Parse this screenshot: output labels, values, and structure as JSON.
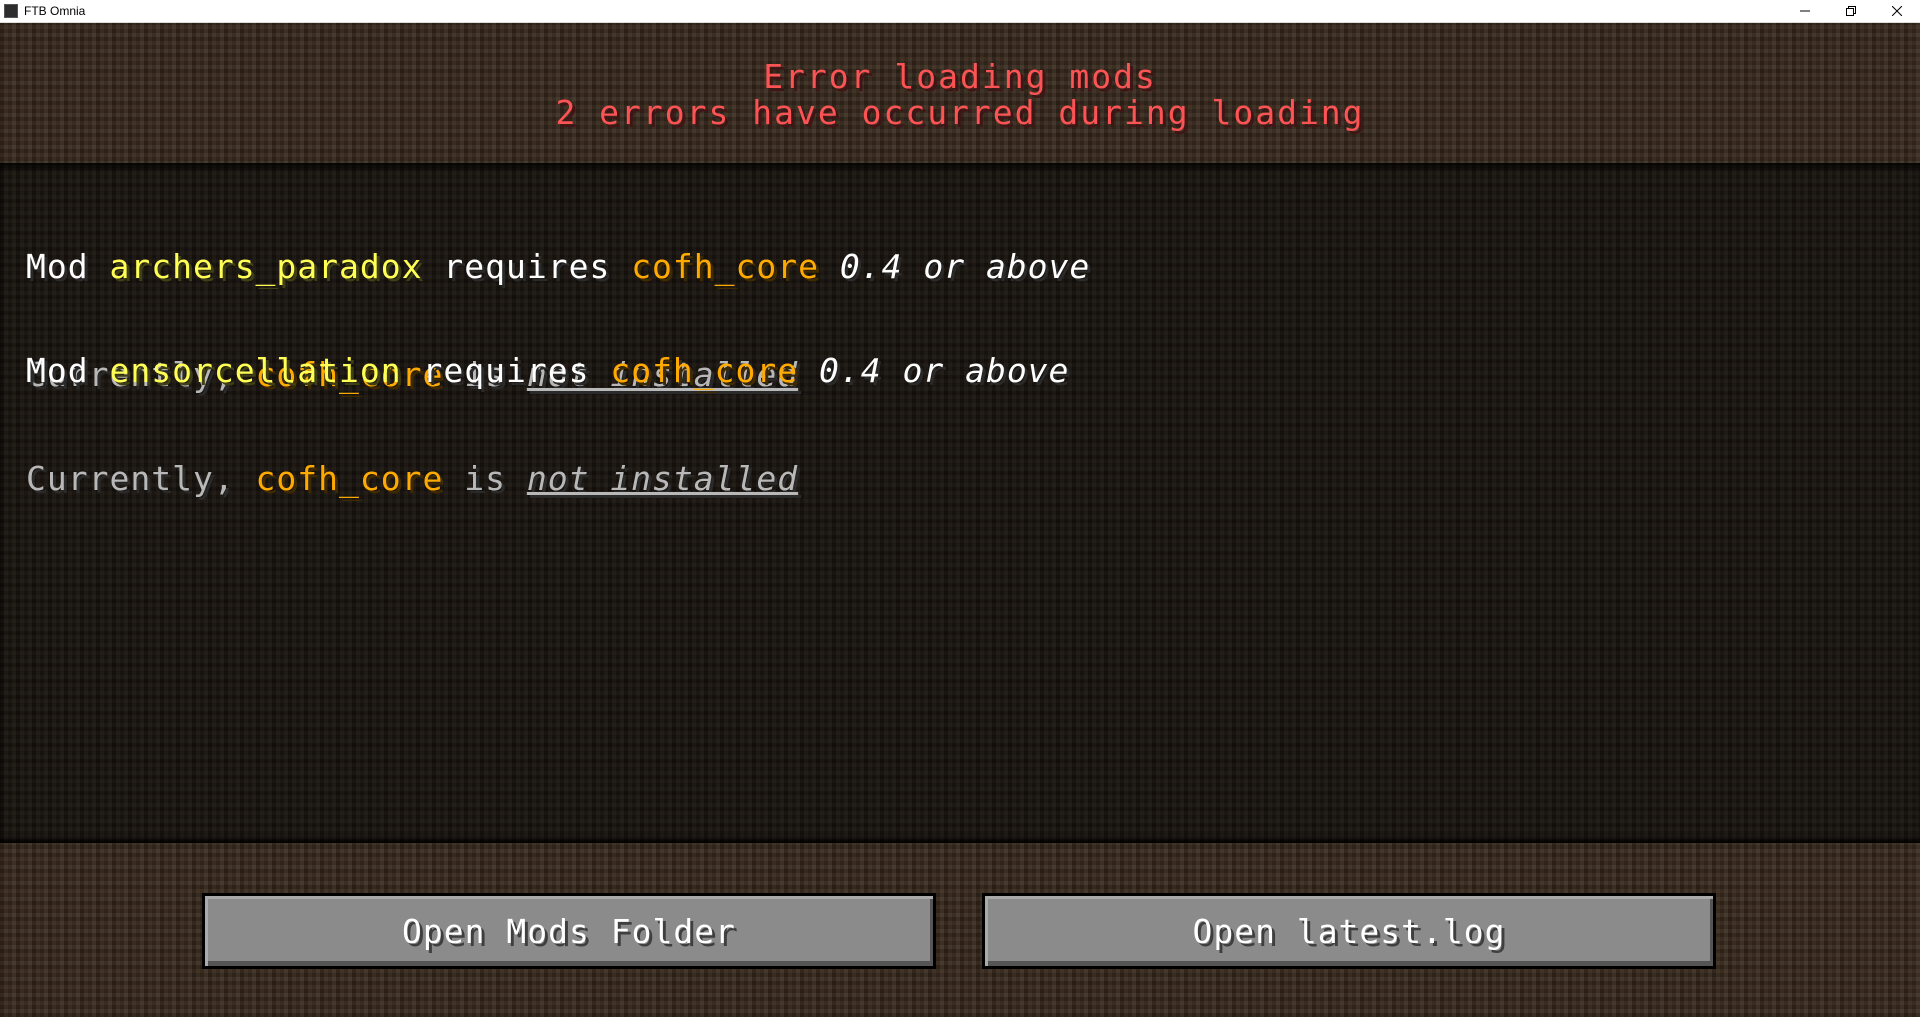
{
  "window": {
    "title": "FTB Omnia",
    "controls": [
      "minimize-icon",
      "restore-icon",
      "close-icon"
    ]
  },
  "header": {
    "title": "Error loading mods",
    "subtitle": "2 errors have occurred during loading"
  },
  "errors": [
    {
      "prefix": "Mod ",
      "mod": "archers_paradox",
      "requires": " requires ",
      "dependency": "cofh_core",
      "version": " 0.4 or above",
      "currently": "Currently, ",
      "current_dep": "cofh_core",
      "is": " is ",
      "status": "not installed"
    },
    {
      "prefix": "Mod ",
      "mod": "ensorcellation",
      "requires": " requires ",
      "dependency": "cofh_core",
      "version": " 0.4 or above",
      "currently": "Currently, ",
      "current_dep": "cofh_core",
      "is": " is ",
      "status": "not installed"
    }
  ],
  "buttons": {
    "open_mods_folder": "Open Mods Folder",
    "open_latest_log": "Open latest.log"
  },
  "colors": {
    "header_red": "#fc5454",
    "mod_yellow": "#ffff55",
    "dependency_gold": "#ffaa00",
    "button_gray": "#8b8b8b"
  }
}
